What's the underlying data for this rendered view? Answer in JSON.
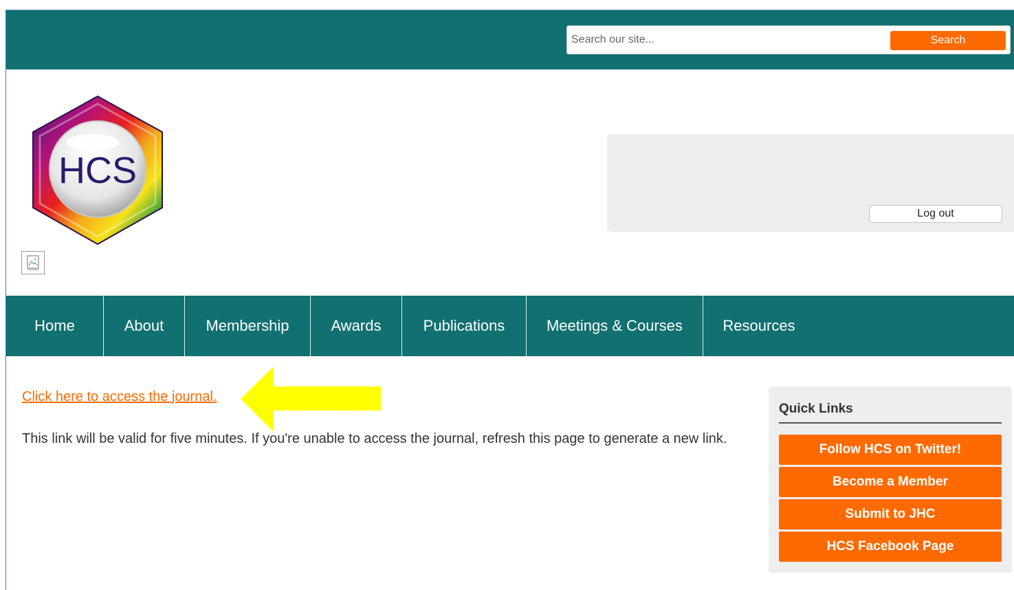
{
  "header": {
    "search": {
      "placeholder": "Search our site...",
      "value": "",
      "button_label": "Search"
    },
    "logo_text": "HCS"
  },
  "account": {
    "logout_label": "Log out"
  },
  "nav": {
    "items": [
      {
        "label": "Home"
      },
      {
        "label": "About"
      },
      {
        "label": "Membership"
      },
      {
        "label": "Awards"
      },
      {
        "label": "Publications"
      },
      {
        "label": "Meetings & Courses"
      },
      {
        "label": "Resources"
      }
    ]
  },
  "main": {
    "journal_link": "Click here to access the journal.",
    "info_text": "This link will be valid for five minutes. If you're unable to access the journal, refresh this page to generate a new link."
  },
  "quick_links": {
    "title": "Quick Links",
    "items": [
      {
        "label": "Follow HCS on Twitter!"
      },
      {
        "label": "Become a Member"
      },
      {
        "label": "Submit to JHC"
      },
      {
        "label": "HCS Facebook Page"
      }
    ]
  },
  "colors": {
    "teal": "#117070",
    "orange": "#ff6a00",
    "panel_gray": "#eeeeee",
    "arrow_yellow": "#ffff00"
  }
}
